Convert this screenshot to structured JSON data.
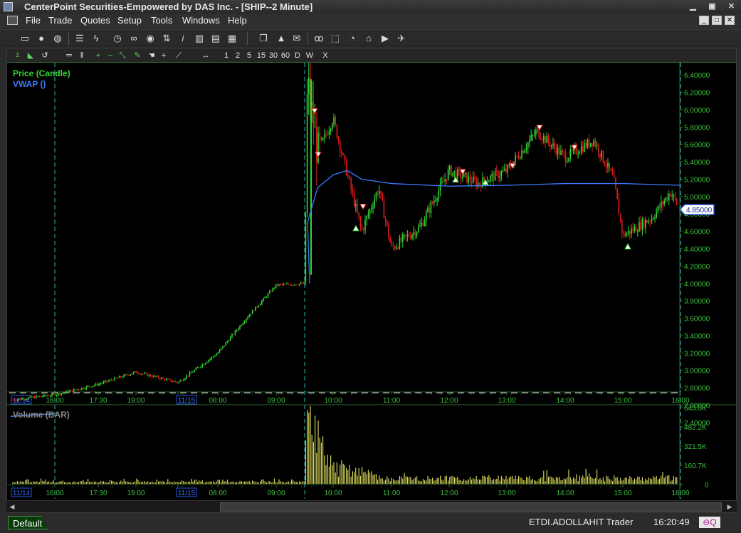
{
  "window": {
    "title": "CenterPoint Securities-Empowered by DAS Inc. - [SHIP--2 Minute]"
  },
  "menu": [
    "File",
    "Trade",
    "Quotes",
    "Setup",
    "Tools",
    "Windows",
    "Help"
  ],
  "toolbar_icons": [
    "window-icon",
    "user-icon",
    "globe-icon",
    "list-icon",
    "lightning-icon",
    "clock-icon",
    "link-icon",
    "eye-icon",
    "sort-icon",
    "info-icon",
    "bar-chart-icon",
    "columns-icon",
    "copy-icon",
    "warning-icon",
    "mail-icon",
    "binoculars-icon",
    "select-icon",
    "history-icon",
    "home-icon",
    "video-icon",
    "twitter-icon"
  ],
  "chart_toolbar": {
    "timeframes": [
      "1",
      "2",
      "5",
      "15",
      "30",
      "60",
      "D",
      "W"
    ],
    "close_label": "X"
  },
  "chart_data": [
    {
      "type": "candlestick",
      "labels": [
        "Price (Candle)",
        "VWAP ()"
      ],
      "legend_colors": [
        "#32d932",
        "#3b7bff"
      ],
      "up_color": "#32d932",
      "down_color": "#e01c1c",
      "vwap_color": "#3b7bff",
      "ylim": [
        2.3,
        6.5
      ],
      "y_ticks": [
        "6.40000",
        "6.20000",
        "6.00000",
        "5.80000",
        "5.60000",
        "5.40000",
        "5.20000",
        "5.00000",
        "4.80000",
        "4.60000",
        "4.40000",
        "4.20000",
        "4.00000",
        "3.80000",
        "3.60000",
        "3.40000",
        "3.20000",
        "3.00000",
        "2.80000",
        "2.60000",
        "2.40000"
      ],
      "x_ticks": [
        "11/14",
        "16:00",
        "17:30",
        "19:00",
        "11/15",
        "08:00",
        "09:00",
        "10:00",
        "11:00",
        "12:00",
        "13:00",
        "14:00",
        "15:00",
        "16:00"
      ],
      "last_price": "4.85000",
      "reference_line": 2.74,
      "session_markers": [
        "16:00",
        "09:30",
        "16:00"
      ],
      "price_path": [
        {
          "t": "11/14",
          "v": 2.66
        },
        {
          "t": "16:00",
          "v": 2.72
        },
        {
          "t": "17:30",
          "v": 2.84
        },
        {
          "t": "19:00",
          "v": 2.98
        },
        {
          "t": "11/15",
          "v": 2.86
        },
        {
          "t": "08:00",
          "v": 3.2
        },
        {
          "t": "08:30",
          "v": 3.6
        },
        {
          "t": "09:00",
          "v": 3.98
        },
        {
          "t": "09:30",
          "v": 4.0
        },
        {
          "t": "09:35",
          "v": 6.35
        },
        {
          "t": "09:45",
          "v": 5.5
        },
        {
          "t": "10:00",
          "v": 5.9
        },
        {
          "t": "10:30",
          "v": 4.6
        },
        {
          "t": "10:45",
          "v": 5.1
        },
        {
          "t": "11:00",
          "v": 4.4
        },
        {
          "t": "11:30",
          "v": 4.65
        },
        {
          "t": "12:00",
          "v": 5.3
        },
        {
          "t": "12:30",
          "v": 5.15
        },
        {
          "t": "13:00",
          "v": 5.3
        },
        {
          "t": "13:30",
          "v": 5.75
        },
        {
          "t": "14:00",
          "v": 5.45
        },
        {
          "t": "14:30",
          "v": 5.65
        },
        {
          "t": "14:50",
          "v": 5.2
        },
        {
          "t": "15:00",
          "v": 4.55
        },
        {
          "t": "15:30",
          "v": 4.75
        },
        {
          "t": "15:50",
          "v": 5.05
        },
        {
          "t": "16:00",
          "v": 4.85
        }
      ],
      "vwap_path": [
        {
          "t": "09:35",
          "v": 4.7
        },
        {
          "t": "09:45",
          "v": 5.1
        },
        {
          "t": "10:00",
          "v": 5.25
        },
        {
          "t": "10:15",
          "v": 5.3
        },
        {
          "t": "10:30",
          "v": 5.2
        },
        {
          "t": "11:00",
          "v": 5.15
        },
        {
          "t": "12:00",
          "v": 5.12
        },
        {
          "t": "13:00",
          "v": 5.13
        },
        {
          "t": "14:00",
          "v": 5.15
        },
        {
          "t": "15:00",
          "v": 5.15
        },
        {
          "t": "16:00",
          "v": 5.13
        }
      ]
    },
    {
      "type": "bar",
      "labels": [
        "Volume (BAR)"
      ],
      "color": "#d6d65a",
      "ylim": [
        0,
        643000
      ],
      "y_ticks": [
        "643.0K",
        "482.2K",
        "321.5K",
        "160.7K",
        "0"
      ],
      "x_ticks": [
        "11/14",
        "16:00",
        "17:30",
        "19:00",
        "11/15",
        "08:00",
        "09:00",
        "10:00",
        "11:00",
        "12:00",
        "13:00",
        "14:00",
        "15:00",
        "16:00"
      ]
    }
  ],
  "status": {
    "layout": "Default",
    "account": "ETDI.ADOLLAHIT  Trader",
    "clock": "16:20:49"
  }
}
